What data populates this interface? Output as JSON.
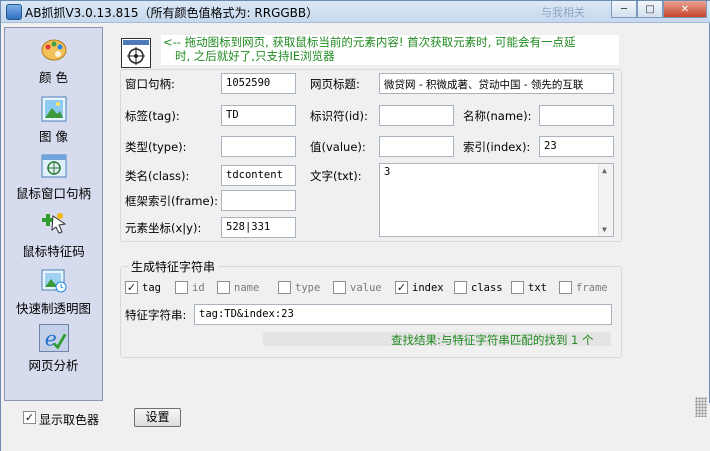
{
  "window": {
    "title": "AB抓抓V3.0.13.815（所有颜色值格式为: RRGGBB）",
    "ghost_title": "与我相关"
  },
  "sidebar": {
    "items": [
      {
        "label": "颜 色",
        "icon": "palette-icon"
      },
      {
        "label": "图 像",
        "icon": "image-icon"
      },
      {
        "label": "鼠标窗口句柄",
        "icon": "window-handle-icon"
      },
      {
        "label": "鼠标特征码",
        "icon": "cursor-feature-icon"
      },
      {
        "label": "快速制透明图",
        "icon": "transparent-image-icon"
      },
      {
        "label": "网页分析",
        "icon": "web-analysis-icon"
      }
    ]
  },
  "hint": {
    "line1": "<-- 拖动图标到网页, 获取鼠标当前的元素内容! 首次获取元素时, 可能会有一点延",
    "line2": "时, 之后就好了,只支持IE浏览器"
  },
  "fields": {
    "hwnd_label": "窗口句柄:",
    "hwnd_value": "1052590",
    "page_title_label": "网页标题:",
    "page_title_value": "微贷网 - 积微成著、贷动中国 - 领先的互联",
    "tag_label": "标签(tag):",
    "tag_value": "TD",
    "id_label": "标识符(id):",
    "id_value": "",
    "name_label": "名称(name):",
    "name_value": "",
    "type_label": "类型(type):",
    "type_value": "",
    "value_label": "值(value):",
    "value_value": "",
    "index_label": "索引(index):",
    "index_value": "23",
    "class_label": "类名(class):",
    "class_value": "tdcontent",
    "text_label": "文字(txt):",
    "text_value": "3",
    "frame_label": "框架索引(frame):",
    "frame_value": "",
    "coords_label": "元素坐标(x|y):",
    "coords_value": "528|331"
  },
  "generate": {
    "title": "生成特征字符串",
    "options": [
      {
        "label": "tag",
        "checked": true
      },
      {
        "label": "id",
        "checked": false
      },
      {
        "label": "name",
        "checked": false
      },
      {
        "label": "type",
        "checked": false
      },
      {
        "label": "value",
        "checked": false
      },
      {
        "label": "index",
        "checked": true
      },
      {
        "label": "class",
        "checked": false
      },
      {
        "label": "txt",
        "checked": false
      },
      {
        "label": "frame",
        "checked": false
      }
    ],
    "feature_label": "特征字符串:",
    "feature_value": "tag:TD&index:23",
    "result_text": "查找结果:与特征字符串匹配的找到 1 个"
  },
  "bottom": {
    "show_picker_label": "显示取色器",
    "show_picker_checked": true,
    "settings_label": "设置"
  }
}
